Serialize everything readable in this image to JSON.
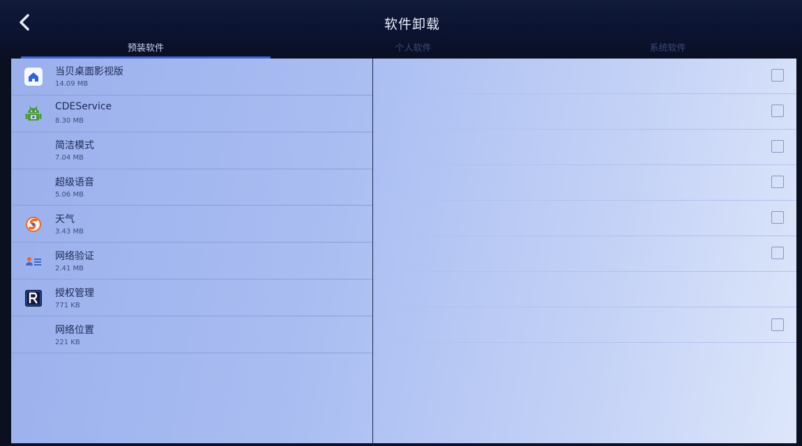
{
  "header": {
    "title": "软件卸载",
    "back_icon": "chevron-left-icon"
  },
  "tabs": [
    {
      "label": "预装软件",
      "active": true
    },
    {
      "label": "个人软件",
      "active": false
    },
    {
      "label": "系统软件",
      "active": false
    }
  ],
  "colors": {
    "accent": "#3f63d8",
    "header_bg": "#0b1330",
    "panel_bg": "#a9bdf2"
  },
  "apps": [
    {
      "name": "当贝桌面影视版",
      "size": "14.09 MB",
      "icon": "home-icon",
      "checkbox": true
    },
    {
      "name": "CDEService",
      "size": "8.30 MB",
      "icon": "android-icon",
      "checkbox": true
    },
    {
      "name": "简洁模式",
      "size": "7.04 MB",
      "icon": "",
      "checkbox": true
    },
    {
      "name": "超级语音",
      "size": "5.06 MB",
      "icon": "",
      "checkbox": true
    },
    {
      "name": "天气",
      "size": "3.43 MB",
      "icon": "weather-icon",
      "checkbox": true
    },
    {
      "name": "网络验证",
      "size": "2.41 MB",
      "icon": "id-card-icon",
      "checkbox": true
    },
    {
      "name": "授权管理",
      "size": "771 KB",
      "icon": "r-badge-icon",
      "checkbox": false
    },
    {
      "name": "网络位置",
      "size": "221 KB",
      "icon": "",
      "checkbox": true
    }
  ]
}
